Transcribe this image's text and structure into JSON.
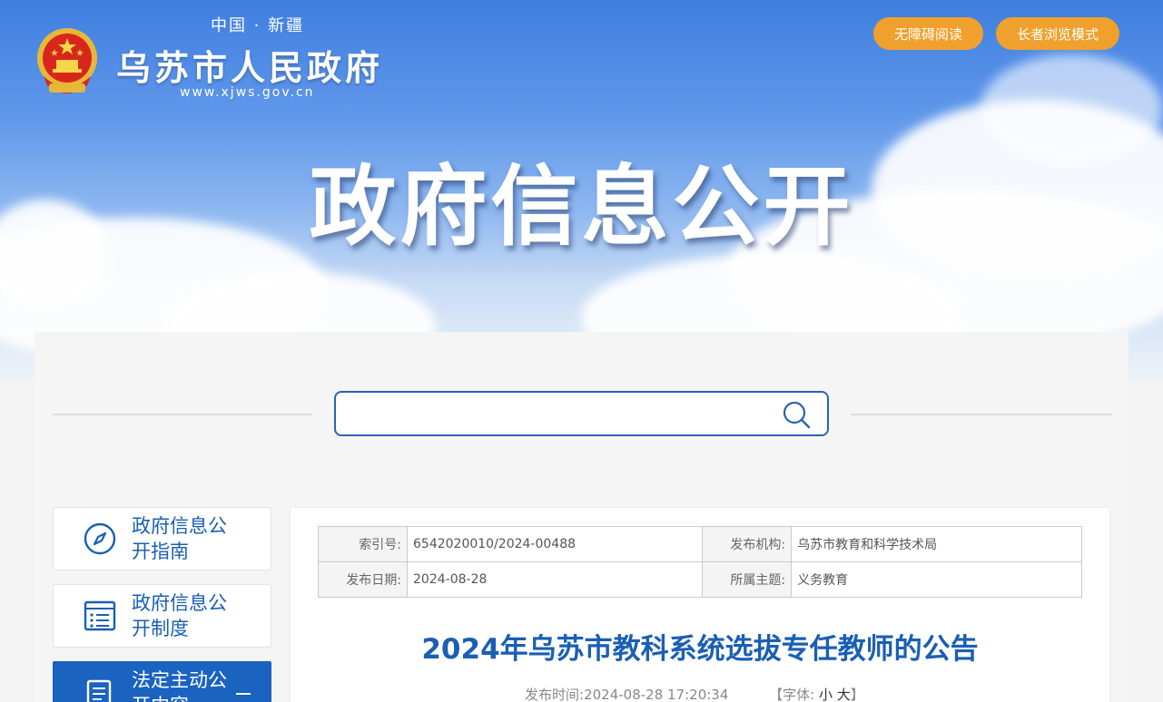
{
  "header": {
    "subtitle": "中国 · 新疆",
    "site_name": "乌苏市人民政府",
    "site_url": "www.xjws.gov.cn",
    "accessibility_button": "无障碍阅读",
    "elder_mode_button": "长者浏览模式",
    "banner_title": "政府信息公开"
  },
  "search": {
    "placeholder": "",
    "icon": "search-icon"
  },
  "sidebar": {
    "items": [
      {
        "label": "政府信息公开指南",
        "icon": "compass-icon",
        "active": false
      },
      {
        "label": "政府信息公开制度",
        "icon": "document-list-icon",
        "active": false
      },
      {
        "label": "法定主动公开内容",
        "icon": "document-icon",
        "active": true
      }
    ]
  },
  "meta": {
    "index_label": "索引号:",
    "index_value": "6542020010/2024-00488",
    "org_label": "发布机构:",
    "org_value": "乌苏市教育和科学技术局",
    "date_label": "发布日期:",
    "date_value": "2024-08-28",
    "topic_label": "所属主题:",
    "topic_value": "义务教育"
  },
  "article": {
    "title": "2024年乌苏市教科系统选拔专任教师的公告",
    "publish_label": "发布时间:",
    "publish_time": "2024-08-28 17:20:34",
    "font_label": "【字体:",
    "font_small": "小",
    "font_large": "大",
    "font_close": "】"
  },
  "colors": {
    "accent": "#1a5fb4",
    "button_orange": "#f0a02c",
    "active_nav": "#1a63c0"
  }
}
